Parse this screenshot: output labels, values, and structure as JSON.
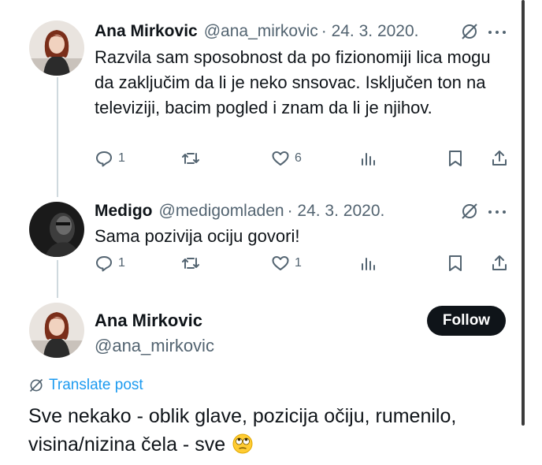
{
  "tweets": [
    {
      "name": "Ana Mirkovic",
      "handle": "@ana_mirkovic",
      "date": "· 24. 3. 2020.",
      "text": "Razvila sam sposobnost da po fizionomiji lica mogu da zaključim da li je neko snsovac. Isključen ton na televiziji, bacim pogled i znam da li je njihov.",
      "replies": "1",
      "reposts": "",
      "likes": "6"
    },
    {
      "name": "Medigo",
      "handle": "@medigomladen",
      "date": "· 24. 3. 2020.",
      "text": "Sama pozivija ociju govori!",
      "replies": "1",
      "reposts": "",
      "likes": "1"
    }
  ],
  "main_post": {
    "name": "Ana Mirkovic",
    "handle": "@ana_mirkovic",
    "follow_label": "Follow",
    "translate_label": "Translate post",
    "text": "Sve nekako - oblik glave, pozicija očiju, rumenilo, visina/nizina čela - sve"
  },
  "icons": {
    "reply": "reply-icon",
    "repost": "repost-icon",
    "like": "heart-icon",
    "views": "views-icon",
    "bookmark": "bookmark-icon",
    "share": "share-icon",
    "grok": "grok-icon",
    "more": "more-icon",
    "emoji": "face-with-rolling-eyes-emoji"
  },
  "colors": {
    "text": "#0f1419",
    "secondary": "#536471",
    "accent": "#1d9bf0",
    "follow_bg": "#0f1419"
  }
}
